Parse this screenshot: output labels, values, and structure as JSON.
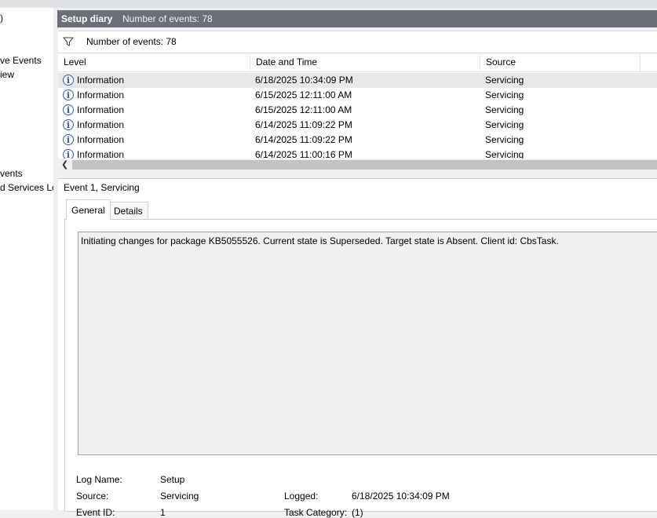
{
  "tree": {
    "items": [
      ")",
      "ve Events",
      "iew",
      "vents",
      "d Services Lo"
    ]
  },
  "header": {
    "title": "Setup diary",
    "subtitle": "Number of events: 78"
  },
  "filter": {
    "text": "Number of events: 78"
  },
  "grid": {
    "columns": [
      "Level",
      "Date and Time",
      "Source"
    ],
    "rows": [
      {
        "level": "Information",
        "date": "6/18/2025 10:34:09 PM",
        "source": "Servicing"
      },
      {
        "level": "Information",
        "date": "6/15/2025 12:11:00 AM",
        "source": "Servicing"
      },
      {
        "level": "Information",
        "date": "6/15/2025 12:11:00 AM",
        "source": "Servicing"
      },
      {
        "level": "Information",
        "date": "6/14/2025 11:09:22 PM",
        "source": "Servicing"
      },
      {
        "level": "Information",
        "date": "6/14/2025 11:09:22 PM",
        "source": "Servicing"
      },
      {
        "level": "Information",
        "date": "6/14/2025 11:00:16 PM",
        "source": "Servicing"
      }
    ]
  },
  "detail": {
    "title": "Event 1, Servicing",
    "tabs": [
      "General",
      "Details"
    ],
    "message": "Initiating changes for package KB5055526. Current state is Superseded. Target state is Absent. Client id: CbsTask.",
    "props": {
      "log_name_label": "Log Name:",
      "log_name": "Setup",
      "source_label": "Source:",
      "source": "Servicing",
      "logged_label": "Logged:",
      "logged": "6/18/2025 10:34:09 PM",
      "event_id_label": "Event ID:",
      "event_id": "1",
      "task_category_label": "Task Category:",
      "task_category": "(1)"
    }
  },
  "colors": {
    "title_bar": "#6b7078",
    "info_icon": "#2f5fa8",
    "selected_row": "#e8e8e8"
  }
}
